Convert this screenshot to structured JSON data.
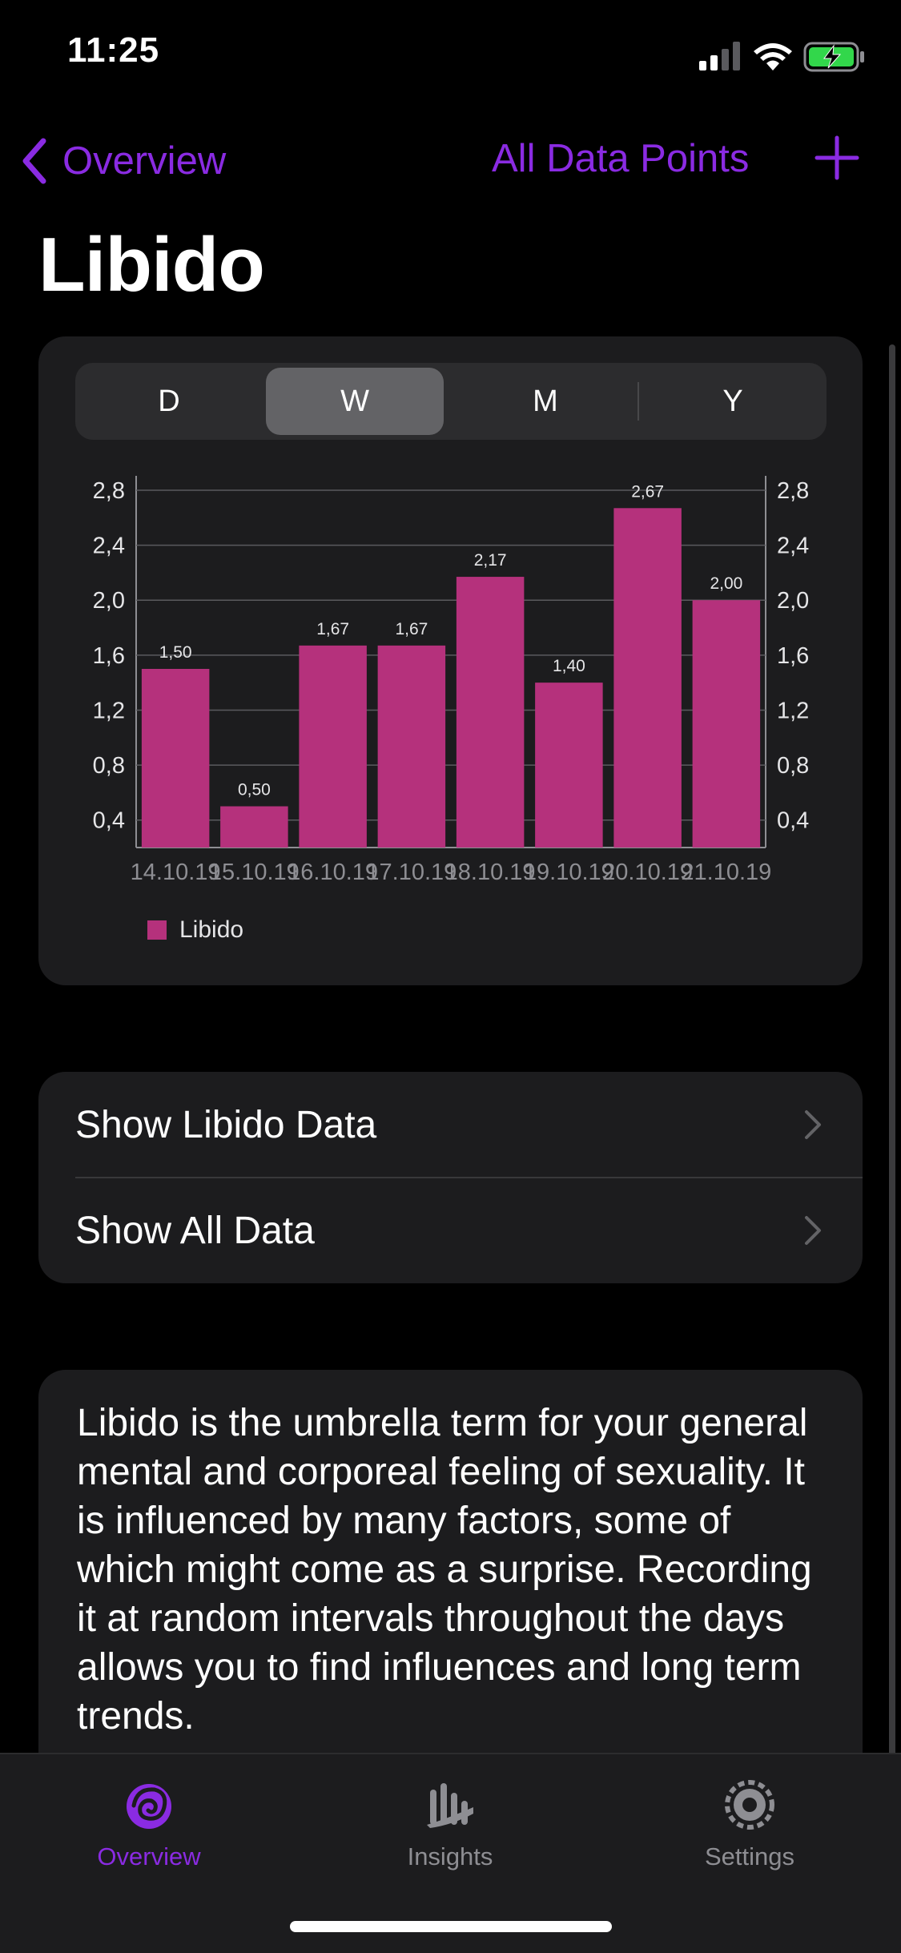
{
  "status_bar": {
    "time": "11:25"
  },
  "nav": {
    "back_label": "Overview",
    "all_points_label": "All Data Points"
  },
  "page": {
    "title": "Libido"
  },
  "segments": [
    {
      "label": "D",
      "selected": false
    },
    {
      "label": "W",
      "selected": true
    },
    {
      "label": "M",
      "selected": false
    },
    {
      "label": "Y",
      "selected": false
    }
  ],
  "chart_data": {
    "type": "bar",
    "categories": [
      "14.10.19",
      "15.10.19",
      "16.10.19",
      "17.10.19",
      "18.10.19",
      "19.10.19",
      "20.10.19",
      "21.10.19"
    ],
    "values": [
      1.5,
      0.5,
      1.67,
      1.67,
      2.17,
      1.4,
      2.67,
      2.0
    ],
    "value_labels": [
      "1,50",
      "0,50",
      "1,67",
      "1,67",
      "2,17",
      "1,40",
      "2,67",
      "2,00"
    ],
    "series": [
      {
        "name": "Libido",
        "values": [
          1.5,
          0.5,
          1.67,
          1.67,
          2.17,
          1.4,
          2.67,
          2.0
        ]
      }
    ],
    "yticks": [
      "0,4",
      "0,8",
      "1,2",
      "1,6",
      "2,0",
      "2,4",
      "2,8"
    ],
    "ylim": [
      0.2,
      2.8
    ],
    "grid": true,
    "legend_position": "bottom-left",
    "bar_color": "#b5317c"
  },
  "legend": {
    "label": "Libido"
  },
  "list": {
    "items": [
      {
        "label": "Show Libido Data"
      },
      {
        "label": "Show All Data"
      }
    ]
  },
  "description": {
    "text": "Libido is the umbrella term for your general mental and corporeal feeling of sexuality. It is influenced by many factors, some of which might come as a surprise. Recording it at random intervals throughout the days allows you to find influences and long term trends."
  },
  "tabbar": {
    "tabs": [
      {
        "label": "Overview",
        "icon": "overview-icon",
        "active": true
      },
      {
        "label": "Insights",
        "icon": "insights-icon",
        "active": false
      },
      {
        "label": "Settings",
        "icon": "settings-icon",
        "active": false
      }
    ]
  },
  "colors": {
    "accent": "#8a2be2",
    "bar": "#b5317c",
    "card": "#1c1c1e",
    "inactive": "#8e8e93"
  }
}
